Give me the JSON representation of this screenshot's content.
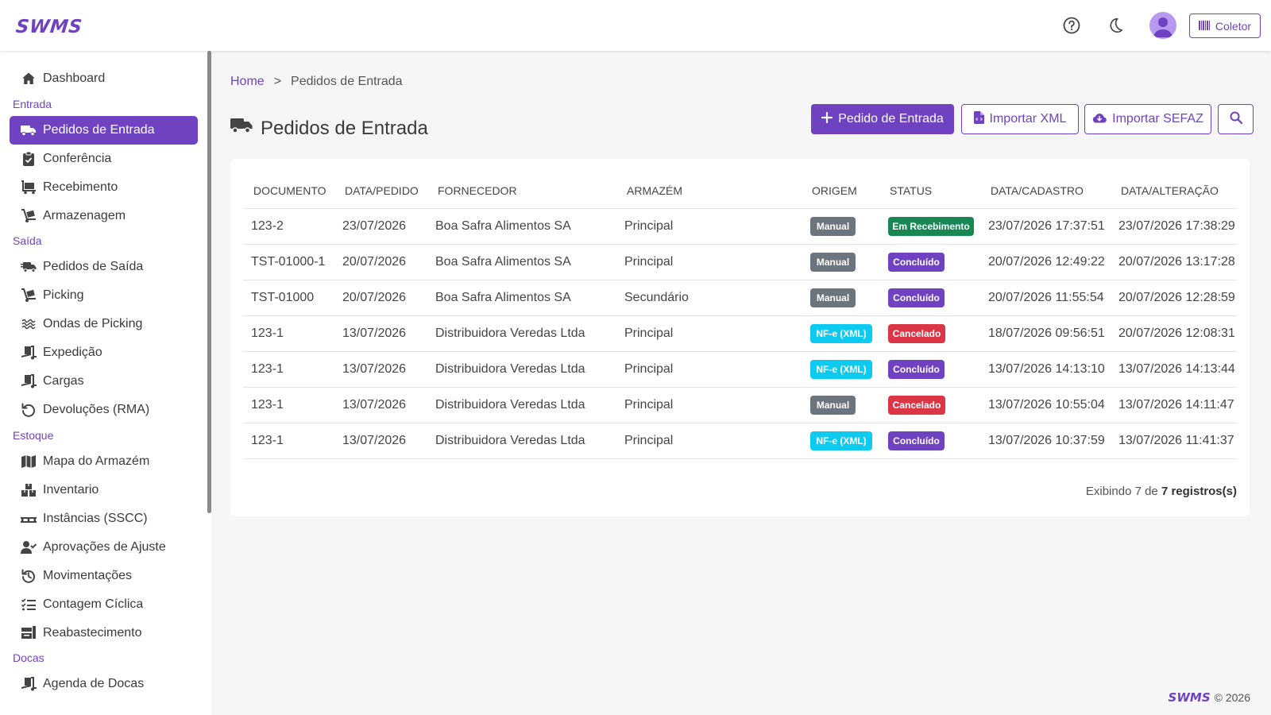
{
  "app": {
    "logo": "SWMS"
  },
  "topbar": {
    "help_icon": "question-circle-icon",
    "theme_icon": "moon-icon",
    "avatar_icon": "user-avatar-icon",
    "coletor_label": "Coletor",
    "coletor_icon": "barcode-icon"
  },
  "sidebar": {
    "dashboard": "Dashboard",
    "sections": {
      "entrada": "Entrada",
      "saida": "Saída",
      "estoque": "Estoque",
      "docas": "Docas"
    },
    "entrada": [
      "Pedidos de Entrada",
      "Conferência",
      "Recebimento",
      "Armazenagem"
    ],
    "saida": [
      "Pedidos de Saída",
      "Picking",
      "Ondas de Picking",
      "Expedição",
      "Cargas",
      "Devoluções (RMA)"
    ],
    "estoque": [
      "Mapa do Armazém",
      "Inventario",
      "Instâncias (SSCC)",
      "Aprovações de Ajuste",
      "Movimentações",
      "Contagem Cíclica",
      "Reabastecimento"
    ],
    "docas": [
      "Agenda de Docas"
    ]
  },
  "breadcrumb": {
    "home": "Home",
    "separator": ">",
    "current": "Pedidos de Entrada"
  },
  "page": {
    "title": "Pedidos de Entrada",
    "title_icon": "truck-icon"
  },
  "actions": {
    "new_order": "Pedido de Entrada",
    "import_xml": "Importar XML",
    "import_sefaz": "Importar SEFAZ",
    "search_icon": "search-icon"
  },
  "table": {
    "headers": [
      "DOCUMENTO",
      "DATA/PEDIDO",
      "FORNECEDOR",
      "ARMAZÉM",
      "ORIGEM",
      "STATUS",
      "DATA/CADASTRO",
      "DATA/ALTERAÇÃO"
    ],
    "rows": [
      {
        "documento": "123-2",
        "data_pedido": "23/07/2026",
        "fornecedor": "Boa Safra Alimentos SA",
        "armazem": "Principal",
        "origem": "Manual",
        "status": "Em Recebimento",
        "data_cadastro": "23/07/2026 17:37:51",
        "data_alteracao": "23/07/2026 17:38:29"
      },
      {
        "documento": "TST-01000-1",
        "data_pedido": "20/07/2026",
        "fornecedor": "Boa Safra Alimentos SA",
        "armazem": "Principal",
        "origem": "Manual",
        "status": "Concluído",
        "data_cadastro": "20/07/2026 12:49:22",
        "data_alteracao": "20/07/2026 13:17:28"
      },
      {
        "documento": "TST-01000",
        "data_pedido": "20/07/2026",
        "fornecedor": "Boa Safra Alimentos SA",
        "armazem": "Secundário",
        "origem": "Manual",
        "status": "Concluído",
        "data_cadastro": "20/07/2026 11:55:54",
        "data_alteracao": "20/07/2026 12:28:59"
      },
      {
        "documento": "123-1",
        "data_pedido": "13/07/2026",
        "fornecedor": "Distribuidora Veredas Ltda",
        "armazem": "Principal",
        "origem": "NF-e (XML)",
        "status": "Cancelado",
        "data_cadastro": "18/07/2026 09:56:51",
        "data_alteracao": "20/07/2026 12:08:31"
      },
      {
        "documento": "123-1",
        "data_pedido": "13/07/2026",
        "fornecedor": "Distribuidora Veredas Ltda",
        "armazem": "Principal",
        "origem": "NF-e (XML)",
        "status": "Concluído",
        "data_cadastro": "13/07/2026 14:13:10",
        "data_alteracao": "13/07/2026 14:13:44"
      },
      {
        "documento": "123-1",
        "data_pedido": "13/07/2026",
        "fornecedor": "Distribuidora Veredas Ltda",
        "armazem": "Principal",
        "origem": "Manual",
        "status": "Cancelado",
        "data_cadastro": "13/07/2026 10:55:04",
        "data_alteracao": "13/07/2026 14:11:47"
      },
      {
        "documento": "123-1",
        "data_pedido": "13/07/2026",
        "fornecedor": "Distribuidora Veredas Ltda",
        "armazem": "Principal",
        "origem": "NF-e (XML)",
        "status": "Concluído",
        "data_cadastro": "13/07/2026 10:37:59",
        "data_alteracao": "13/07/2026 11:41:37"
      }
    ],
    "footer_prefix": "Exibindo 7 de ",
    "footer_bold": "7 registros(s)"
  },
  "colors": {
    "primary": "#6f42c1",
    "manual": "#6c757d",
    "nfe": "#0dcaf0",
    "em_recebimento": "#198754",
    "concluido": "#6f42c1",
    "cancelado": "#dc3545"
  },
  "footer": {
    "logo": "SWMS",
    "copyright": "© 2026"
  }
}
